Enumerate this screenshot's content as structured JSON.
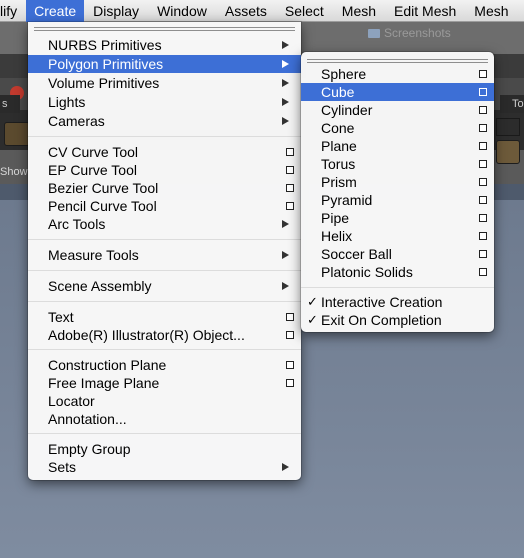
{
  "menubar": {
    "items": [
      "lify",
      "Create",
      "Display",
      "Window",
      "Assets",
      "Select",
      "Mesh",
      "Edit Mesh",
      "Mesh"
    ]
  },
  "background": {
    "folder_label": "Screenshots",
    "show_label": "Show",
    "tab_left": "s",
    "tab_right": "To"
  },
  "create_menu": {
    "items": [
      {
        "label": "NURBS Primitives",
        "type": "submenu"
      },
      {
        "label": "Polygon Primitives",
        "type": "submenu",
        "highlighted": true
      },
      {
        "label": "Volume Primitives",
        "type": "submenu"
      },
      {
        "label": "Lights",
        "type": "submenu"
      },
      {
        "label": "Cameras",
        "type": "submenu"
      },
      {
        "label": "CV Curve Tool",
        "type": "option"
      },
      {
        "label": "EP Curve Tool",
        "type": "option"
      },
      {
        "label": "Bezier Curve Tool",
        "type": "option"
      },
      {
        "label": "Pencil Curve Tool",
        "type": "option"
      },
      {
        "label": "Arc Tools",
        "type": "submenu"
      },
      {
        "label": "Measure Tools",
        "type": "submenu"
      },
      {
        "label": "Scene Assembly",
        "type": "submenu"
      },
      {
        "label": "Text",
        "type": "option"
      },
      {
        "label": "Adobe(R) Illustrator(R) Object...",
        "type": "option"
      },
      {
        "label": "Construction Plane",
        "type": "option"
      },
      {
        "label": "Free Image Plane",
        "type": "option"
      },
      {
        "label": "Locator",
        "type": "plain"
      },
      {
        "label": "Annotation...",
        "type": "plain"
      },
      {
        "label": "Empty Group",
        "type": "plain"
      },
      {
        "label": "Sets",
        "type": "submenu"
      }
    ]
  },
  "polygon_submenu": {
    "items": [
      {
        "label": "Sphere",
        "type": "option"
      },
      {
        "label": "Cube",
        "type": "option",
        "highlighted": true
      },
      {
        "label": "Cylinder",
        "type": "option"
      },
      {
        "label": "Cone",
        "type": "option"
      },
      {
        "label": "Plane",
        "type": "option"
      },
      {
        "label": "Torus",
        "type": "option"
      },
      {
        "label": "Prism",
        "type": "option"
      },
      {
        "label": "Pyramid",
        "type": "option"
      },
      {
        "label": "Pipe",
        "type": "option"
      },
      {
        "label": "Helix",
        "type": "option"
      },
      {
        "label": "Soccer Ball",
        "type": "option"
      },
      {
        "label": "Platonic Solids",
        "type": "option"
      },
      {
        "label": "Interactive Creation",
        "type": "check",
        "checked": true
      },
      {
        "label": "Exit On Completion",
        "type": "check",
        "checked": true
      }
    ],
    "check_mark": "✓"
  },
  "colors": {
    "highlight": "#3d6fd6",
    "menu_background": "#f8f8f8",
    "viewport": "#7f8ca0"
  }
}
